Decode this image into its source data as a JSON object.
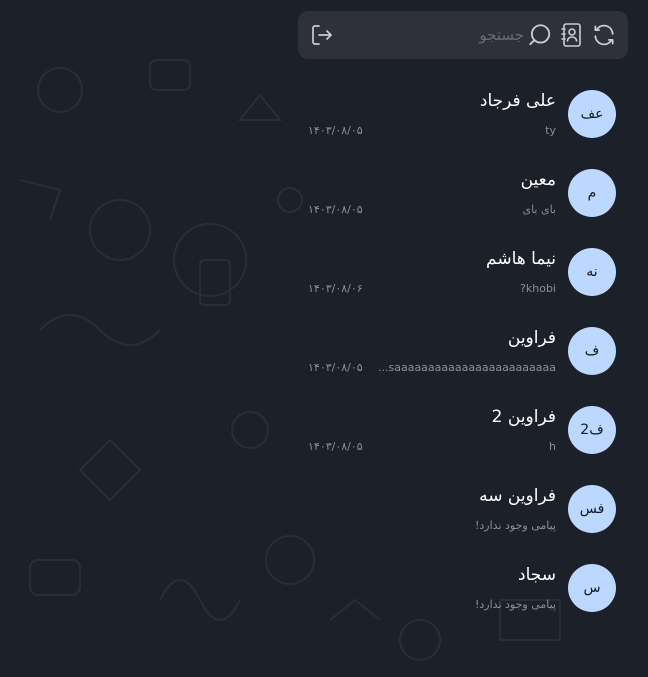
{
  "search": {
    "placeholder": "جستجو"
  },
  "icons": {
    "refresh": "refresh-icon",
    "contacts": "contacts-book-icon",
    "search": "search-icon",
    "logout": "logout-icon"
  },
  "colors": {
    "background": "#1c2029",
    "topbar": "#2e3139",
    "avatar": "#bcd8ff",
    "name": "#ffffff",
    "meta": "#8b8f96"
  },
  "chats": [
    {
      "avatar": "عف",
      "name": "علی فرجاد",
      "preview": "ty",
      "date": "۱۴۰۳/۰۸/۰۵"
    },
    {
      "avatar": "م",
      "name": "معین",
      "preview": "بای بای",
      "date": "۱۴۰۳/۰۸/۰۵"
    },
    {
      "avatar": "نه",
      "name": "نیما هاشم",
      "preview": "khobi?",
      "date": "۱۴۰۳/۰۸/۰۶"
    },
    {
      "avatar": "ف",
      "name": "فراوین",
      "preview": "saaaaaaaaaaaaaaaaaaaaaaaa...",
      "date": "۱۴۰۳/۰۸/۰۵"
    },
    {
      "avatar": "ف2",
      "name": "فراوین 2",
      "preview": "h",
      "date": "۱۴۰۳/۰۸/۰۵"
    },
    {
      "avatar": "فس",
      "name": "فراوین سه",
      "preview": "پیامی وجود ندارد!",
      "date": ""
    },
    {
      "avatar": "س",
      "name": "سجاد",
      "preview": "پیامی وجود ندارد!",
      "date": ""
    }
  ]
}
